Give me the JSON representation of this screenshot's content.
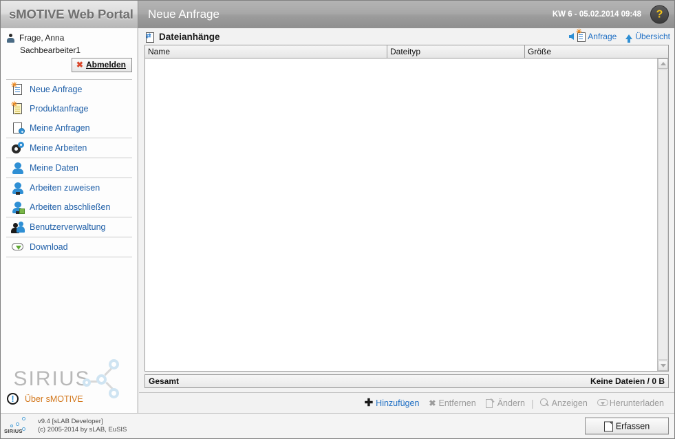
{
  "app": {
    "brand": "sMOTIVE Web Portal",
    "page_title": "Neue Anfrage",
    "datestamp": "KW 6 - 05.02.2014 09:48",
    "help_icon": "question-mark-icon",
    "accent_link_color": "#1f6fc4",
    "accent_icon_color": "#2f8fd4"
  },
  "sidebar": {
    "user": {
      "name": "Frage, Anna",
      "role": "Sachbearbeiter1",
      "logout_label": "Abmelden",
      "logout_icon": "red-x-icon",
      "user_icon": "user-icon"
    },
    "groups": [
      {
        "items": [
          {
            "label": "Neue Anfrage",
            "icon": "new-document-icon"
          },
          {
            "label": "Produktanfrage",
            "icon": "new-product-document-icon"
          },
          {
            "label": "Meine Anfragen",
            "icon": "document-settings-icon"
          }
        ]
      },
      {
        "items": [
          {
            "label": "Meine Arbeiten",
            "icon": "gears-icon"
          }
        ]
      },
      {
        "items": [
          {
            "label": "Meine Daten",
            "icon": "person-icon"
          }
        ]
      },
      {
        "items": [
          {
            "label": "Arbeiten zuweisen",
            "icon": "person-assign-icon"
          },
          {
            "label": "Arbeiten abschließen",
            "icon": "person-complete-icon"
          }
        ]
      },
      {
        "items": [
          {
            "label": "Benutzerverwaltung",
            "icon": "users-icon"
          }
        ]
      },
      {
        "items": [
          {
            "label": "Download",
            "icon": "cloud-download-icon"
          }
        ]
      }
    ],
    "watermark": "SIRIUS",
    "about": {
      "label": "Über sMOTIVE",
      "icon": "info-icon"
    }
  },
  "main": {
    "panel_title": "Dateianhänge",
    "panel_icon": "attachment-icon",
    "head_links": [
      {
        "label": "Anfrage",
        "icon": "arrow-left-icon"
      },
      {
        "label": "Übersicht",
        "icon": "arrow-up-icon"
      }
    ],
    "table": {
      "columns": [
        "Name",
        "Dateityp",
        "Größe"
      ],
      "rows": []
    },
    "total": {
      "label": "Gesamt",
      "value": "Keine Dateien / 0 B"
    },
    "actions": [
      {
        "label": "Hinzufügen",
        "icon": "plus-icon",
        "enabled": true
      },
      {
        "label": "Entfernen",
        "icon": "x-icon",
        "enabled": false
      },
      {
        "label": "Ändern",
        "icon": "pencil-icon",
        "enabled": false
      },
      {
        "label": "Anzeigen",
        "icon": "magnifier-icon",
        "enabled": false
      },
      {
        "label": "Herunterladen",
        "icon": "cloud-download-icon",
        "enabled": false
      }
    ]
  },
  "footer": {
    "logo": "SIRIUS",
    "version": "v9.4 [sLAB Developer]",
    "copyright": "(c) 2005-2014 by sLAB, EuSIS",
    "submit_label": "Erfassen",
    "submit_icon": "page-icon"
  }
}
